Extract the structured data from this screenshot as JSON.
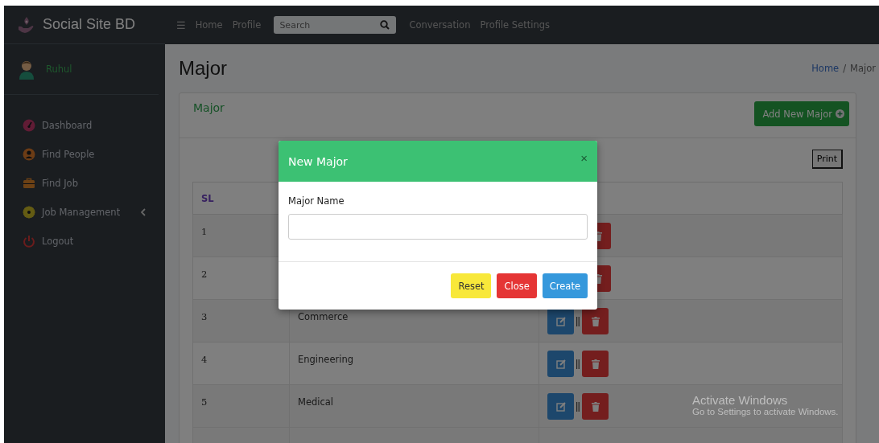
{
  "brand": {
    "title": "Social Site BD"
  },
  "topbar": {
    "menu_icon": "☰",
    "links": [
      "Home",
      "Profile"
    ],
    "search": {
      "placeholder": "Search"
    },
    "links_after": [
      "Conversation",
      "Profile Settings"
    ]
  },
  "user": {
    "name": "Ruhul"
  },
  "sidebar": {
    "items": [
      {
        "label": "Dashboard",
        "kind": "gauge",
        "expandable": false
      },
      {
        "label": "Find People",
        "kind": "user",
        "expandable": false
      },
      {
        "label": "Find Job",
        "kind": "briefcase",
        "expandable": false
      },
      {
        "label": "Job Management",
        "kind": "gear",
        "expandable": true
      },
      {
        "label": "Logout",
        "kind": "power",
        "expandable": false
      }
    ]
  },
  "page": {
    "title": "Major",
    "breadcrumb_separator": "/",
    "breadcrumb": [
      {
        "label": "Home",
        "link": true
      },
      {
        "label": "Major",
        "link": false
      }
    ]
  },
  "card": {
    "title": "Major",
    "add_button": "Add New Major",
    "print_button": "Print"
  },
  "table": {
    "columns": [
      "SL"
    ],
    "rows": [
      {
        "sl": "1"
      },
      {
        "sl": "2"
      },
      {
        "sl": "3",
        "name": "Commerce"
      },
      {
        "sl": "4",
        "name": "Engineering"
      },
      {
        "sl": "5",
        "name": "Medical"
      }
    ]
  },
  "modal": {
    "title": "New Major",
    "close": "×",
    "field": {
      "label": "Major Name"
    },
    "buttons": [
      {
        "label": "Reset",
        "kind": "warning"
      },
      {
        "label": "Close",
        "kind": "danger"
      },
      {
        "label": "Create",
        "kind": "primary"
      }
    ]
  },
  "os_notice": {
    "title": "Activate Windows",
    "text": "Go to Settings to activate Windows."
  }
}
